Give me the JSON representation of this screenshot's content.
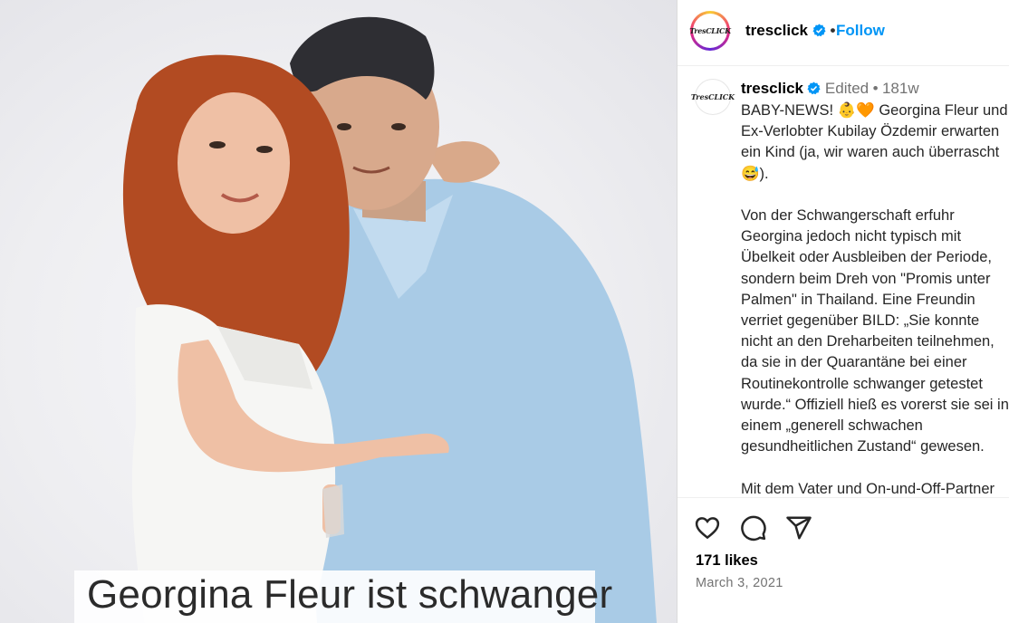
{
  "post": {
    "image_caption": "Georgina Fleur ist schwanger"
  },
  "header": {
    "avatar_text": "TresCLICK",
    "username": "tresclick",
    "separator": "•",
    "follow_label": "Follow"
  },
  "caption": {
    "username": "tresclick",
    "edited_label": "Edited",
    "separator": "•",
    "age": "181w",
    "text": "BABY-NEWS! 👶🧡 Georgina Fleur und Ex-Verlobter Kubilay Özdemir erwarten ein Kind (ja, wir waren auch überrascht 😅).\n\nVon der Schwangerschaft erfuhr Georgina jedoch nicht typisch mit Übelkeit oder Ausbleiben der Periode, sondern beim Dreh von \"Promis unter Palmen\" in Thailand. Eine Freundin verriet gegenüber BILD: „Sie konnte nicht an den Dreharbeiten teilnehmen, da sie in der Quarantäne bei einer Routinekontrolle schwanger getestet wurde.“ Offiziell hieß es vorerst sie sei in einem „generell schwachen gesundheitlichen Zustand“ gewesen.\n\nMit dem Vater und On-und-Off-Partner"
  },
  "footer": {
    "likes": "171 likes",
    "date": "March 3, 2021"
  },
  "colors": {
    "accent": "#0095f6",
    "muted": "#737373",
    "verified": "#0095f6"
  },
  "icons": [
    "heart-icon",
    "comment-icon",
    "share-icon",
    "verified-icon"
  ]
}
